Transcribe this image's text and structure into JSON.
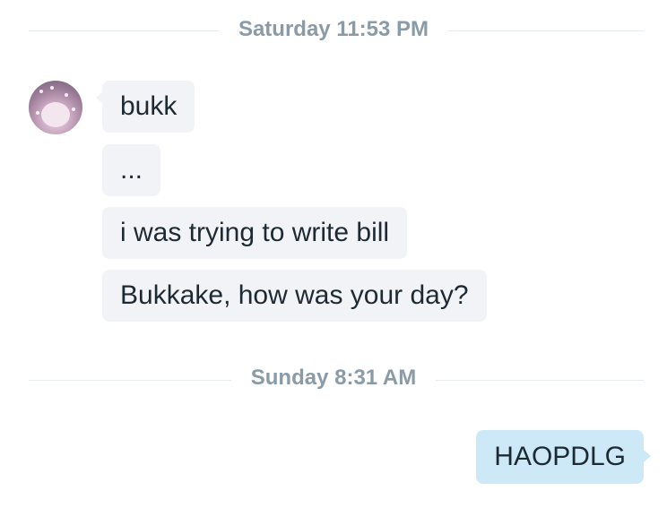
{
  "colors": {
    "timestamp_text": "#8a9ba8",
    "divider": "#e6ecf0",
    "incoming_bubble": "#f1f3f6",
    "outgoing_bubble": "#cde9f8",
    "message_text": "#1d2a33"
  },
  "conversation": {
    "groups": [
      {
        "timestamp": "Saturday 11:53 PM",
        "sender": "other",
        "avatar_icon": "user-avatar",
        "messages": [
          "bukk",
          "...",
          "i was trying to write bill",
          "Bukkake, how was your day?"
        ]
      },
      {
        "timestamp": "Sunday 8:31 AM",
        "sender": "me",
        "messages": [
          "HAOPDLG"
        ]
      }
    ]
  }
}
